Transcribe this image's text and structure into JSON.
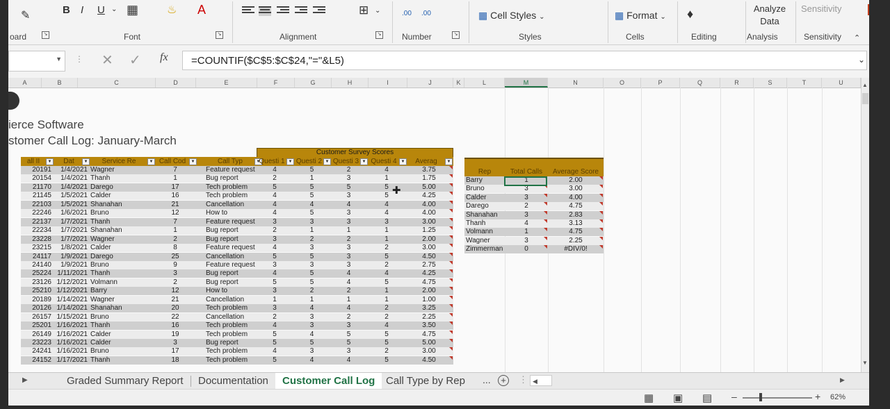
{
  "ribbon": {
    "bold": "B",
    "italic": "I",
    "underline": "U",
    "font_color_glyph": "A",
    "groups": {
      "clipboard": "oard",
      "font": "Font",
      "alignment": "Alignment",
      "number": "Number",
      "styles": "Styles",
      "cells": "Cells",
      "editing": "Editing",
      "analysis": "Analysis",
      "sensitivity": "Sensitivity"
    },
    "cell_styles": "Cell Styles",
    "format": "Format",
    "analyze_data": "Analyze Data",
    "sensitivity_btn": "Sensitivity",
    "decimal_inc": ".00",
    "decimal_dec": ".00"
  },
  "formula_bar": {
    "fx": "fx",
    "formula": "=COUNTIF($C$5:$C$24,\"=\"&L5)"
  },
  "columns": [
    "A",
    "B",
    "C",
    "D",
    "E",
    "F",
    "G",
    "H",
    "I",
    "J",
    "K",
    "L",
    "M",
    "N",
    "O",
    "P",
    "Q",
    "R",
    "S",
    "T",
    "U"
  ],
  "selected_column": "M",
  "sheet": {
    "company": "ierce Software",
    "subtitle": "stomer Call Log: January-March",
    "survey_band": "Customer Survey Scores",
    "headers": [
      "all II",
      "Dat",
      "Service Re",
      "Call Cod",
      "Call Typ",
      "Questi 1",
      "Questi 2",
      "Questi 3",
      "Questi 4",
      "Averag"
    ],
    "rows": [
      [
        "20191",
        "1/4/2021",
        "Wagner",
        "7",
        "Feature request",
        "4",
        "5",
        "2",
        "4",
        "3.75"
      ],
      [
        "20154",
        "1/4/2021",
        "Thanh",
        "1",
        "Bug report",
        "2",
        "1",
        "3",
        "1",
        "1.75"
      ],
      [
        "21170",
        "1/4/2021",
        "Darego",
        "17",
        "Tech problem",
        "5",
        "5",
        "5",
        "5",
        "5.00"
      ],
      [
        "21145",
        "1/5/2021",
        "Calder",
        "16",
        "Tech problem",
        "4",
        "5",
        "3",
        "5",
        "4.25"
      ],
      [
        "22103",
        "1/5/2021",
        "Shanahan",
        "21",
        "Cancellation",
        "4",
        "4",
        "4",
        "4",
        "4.00"
      ],
      [
        "22246",
        "1/6/2021",
        "Bruno",
        "12",
        "How to",
        "4",
        "5",
        "3",
        "4",
        "4.00"
      ],
      [
        "22137",
        "1/7/2021",
        "Thanh",
        "7",
        "Feature request",
        "3",
        "3",
        "3",
        "3",
        "3.00"
      ],
      [
        "22234",
        "1/7/2021",
        "Shanahan",
        "1",
        "Bug report",
        "2",
        "1",
        "1",
        "1",
        "1.25"
      ],
      [
        "23228",
        "1/7/2021",
        "Wagner",
        "2",
        "Bug report",
        "3",
        "2",
        "2",
        "1",
        "2.00"
      ],
      [
        "23215",
        "1/8/2021",
        "Calder",
        "8",
        "Feature request",
        "4",
        "3",
        "3",
        "2",
        "3.00"
      ],
      [
        "24117",
        "1/9/2021",
        "Darego",
        "25",
        "Cancellation",
        "5",
        "5",
        "3",
        "5",
        "4.50"
      ],
      [
        "24140",
        "1/9/2021",
        "Bruno",
        "9",
        "Feature request",
        "3",
        "3",
        "3",
        "2",
        "2.75"
      ],
      [
        "25224",
        "1/11/2021",
        "Thanh",
        "3",
        "Bug report",
        "4",
        "5",
        "4",
        "4",
        "4.25"
      ],
      [
        "23126",
        "1/12/2021",
        "Volmann",
        "2",
        "Bug report",
        "5",
        "5",
        "4",
        "5",
        "4.75"
      ],
      [
        "25210",
        "1/12/2021",
        "Barry",
        "12",
        "How to",
        "3",
        "2",
        "2",
        "1",
        "2.00"
      ],
      [
        "20189",
        "1/14/2021",
        "Wagner",
        "21",
        "Cancellation",
        "1",
        "1",
        "1",
        "1",
        "1.00"
      ],
      [
        "20126",
        "1/14/2021",
        "Shanahan",
        "20",
        "Tech problem",
        "3",
        "4",
        "4",
        "2",
        "3.25"
      ],
      [
        "26157",
        "1/15/2021",
        "Bruno",
        "22",
        "Cancellation",
        "2",
        "3",
        "2",
        "2",
        "2.25"
      ],
      [
        "25201",
        "1/16/2021",
        "Thanh",
        "16",
        "Tech problem",
        "4",
        "3",
        "3",
        "4",
        "3.50"
      ],
      [
        "26149",
        "1/16/2021",
        "Calder",
        "19",
        "Tech problem",
        "5",
        "4",
        "5",
        "5",
        "4.75"
      ],
      [
        "23223",
        "1/16/2021",
        "Calder",
        "3",
        "Bug report",
        "5",
        "5",
        "5",
        "5",
        "5.00"
      ],
      [
        "24241",
        "1/16/2021",
        "Bruno",
        "17",
        "Tech problem",
        "4",
        "3",
        "3",
        "2",
        "3.00"
      ],
      [
        "24152",
        "1/17/2021",
        "Thanh",
        "18",
        "Tech problem",
        "5",
        "4",
        "4",
        "5",
        "4.50"
      ]
    ],
    "summary_headers": [
      "Rep",
      "Total Calls",
      "Average Score"
    ],
    "summary": [
      [
        "Barry",
        "1",
        "2.00"
      ],
      [
        "Bruno",
        "3",
        "3.00"
      ],
      [
        "Calder",
        "3",
        "4.00"
      ],
      [
        "Darego",
        "2",
        "4.75"
      ],
      [
        "Shanahan",
        "3",
        "2.83"
      ],
      [
        "Thanh",
        "4",
        "3.13"
      ],
      [
        "Volmann",
        "1",
        "4.75"
      ],
      [
        "Wagner",
        "3",
        "2.25"
      ],
      [
        "Zimmerman",
        "0",
        "#DIV/0!"
      ]
    ]
  },
  "tabs": [
    "Graded Summary Report",
    "Documentation",
    "Customer Call Log",
    "Call Type by Rep"
  ],
  "active_tab": "Customer Call Log",
  "tabs_more": "...",
  "zoom": "62%",
  "colors": {
    "header_band": "#b8860b",
    "row_alt": "#c9c9c9",
    "excel_green": "#217346"
  }
}
